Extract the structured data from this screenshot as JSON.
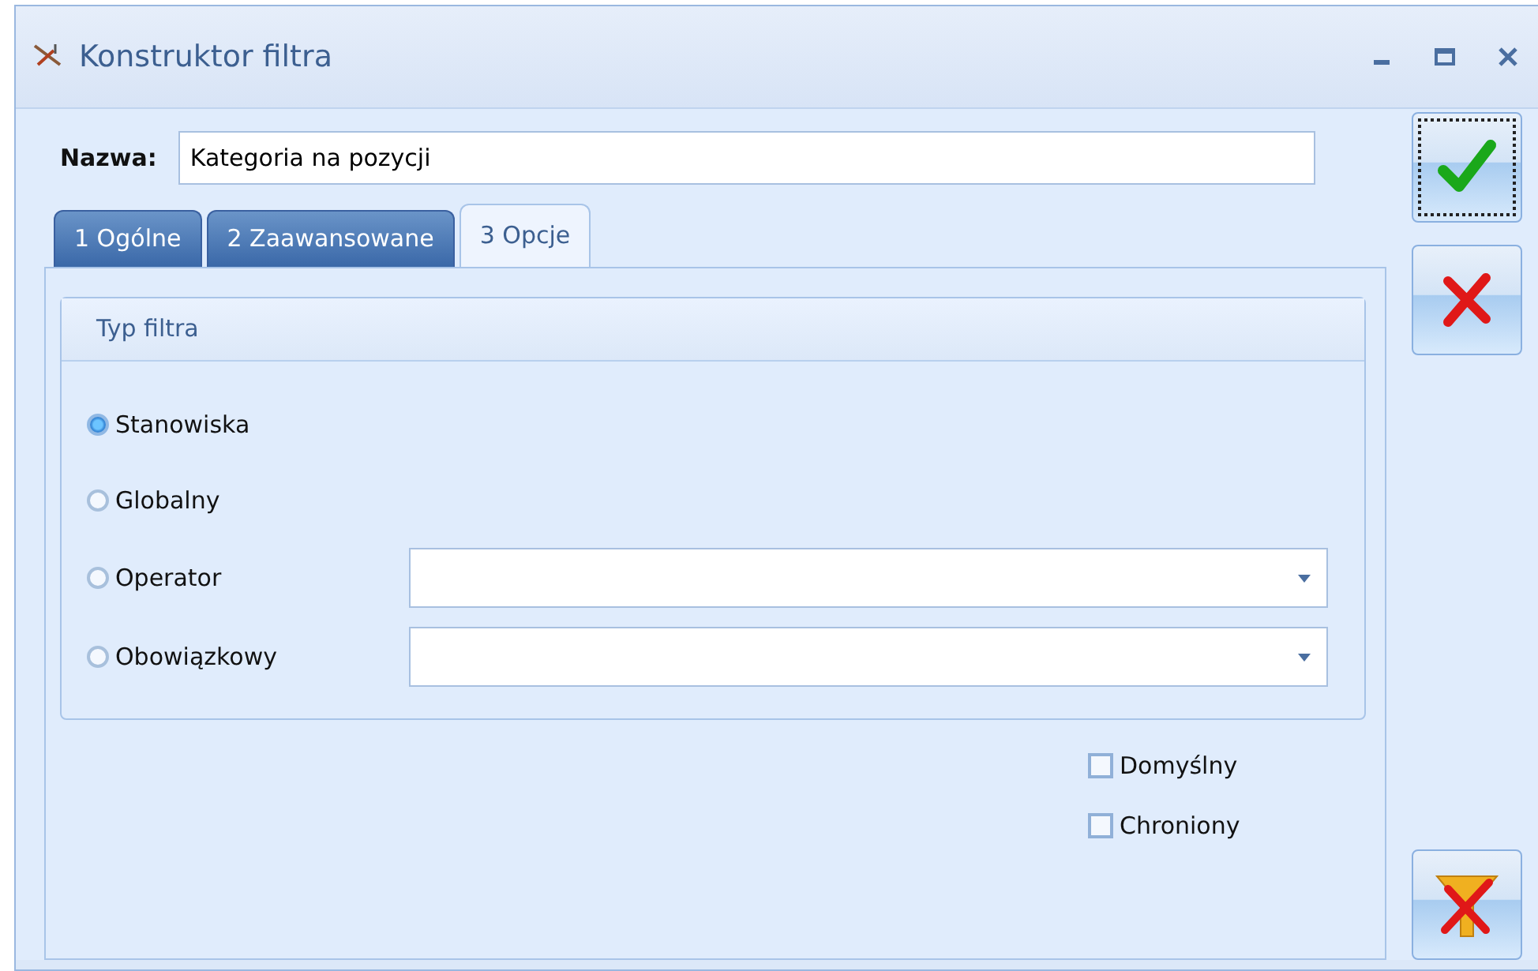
{
  "window": {
    "title": "Konstruktor filtra"
  },
  "name_field": {
    "label": "Nazwa:",
    "value": "Kategoria na pozycji"
  },
  "tabs": [
    {
      "label": "1 Ogólne",
      "selected": false
    },
    {
      "label": "2 Zaawansowane",
      "selected": false
    },
    {
      "label": "3 Opcje",
      "selected": true
    }
  ],
  "group": {
    "title": "Typ filtra",
    "options": [
      {
        "label": "Stanowiska",
        "selected": true,
        "kind": "plain"
      },
      {
        "label": "Globalny",
        "selected": false,
        "kind": "plain"
      },
      {
        "label": "Operator",
        "selected": false,
        "kind": "dropdown"
      },
      {
        "label": "Obowiązkowy",
        "selected": false,
        "kind": "dropdown"
      }
    ]
  },
  "checkboxes": [
    {
      "label": "Domyślny",
      "checked": false
    },
    {
      "label": "Chroniony",
      "checked": false
    }
  ]
}
